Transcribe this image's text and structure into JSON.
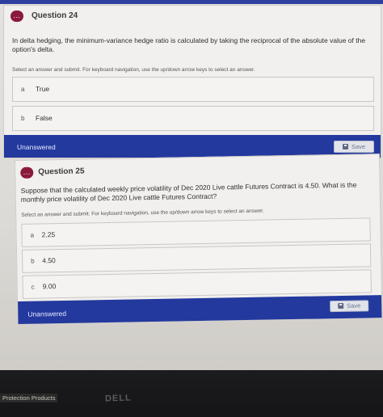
{
  "questions": [
    {
      "badge": "...",
      "title": "Question 24",
      "text": "In delta hedging, the minimum-variance hedge ratio is calculated by taking the reciprocal of the absolute value of the option's delta.",
      "hint": "Select an answer and submit. For keyboard navigation, use the up/down arrow keys to select an answer.",
      "options": [
        {
          "letter": "a",
          "label": "True"
        },
        {
          "letter": "b",
          "label": "False"
        }
      ],
      "status": "Unanswered",
      "save_label": "Save"
    },
    {
      "badge": "...",
      "title": "Question 25",
      "text": "Suppose that the calculated weekly price volatility of Dec 2020 Live cattle Futures Contract is 4.50. What is the monthly price volatility of Dec 2020 Live cattle Futures Contract?",
      "hint": "Select an answer and submit. For keyboard navigation, use the up/down arrow keys to select an answer.",
      "options": [
        {
          "letter": "a",
          "label": "2.25"
        },
        {
          "letter": "b",
          "label": "4.50"
        },
        {
          "letter": "c",
          "label": "9.00"
        }
      ],
      "status": "Unanswered",
      "save_label": "Save"
    }
  ],
  "taskbar": {
    "text": "Protection Products"
  },
  "monitor": {
    "brand": "DELL"
  },
  "colors": {
    "accent_bar": "#23399e",
    "badge": "#8a1a3c"
  }
}
